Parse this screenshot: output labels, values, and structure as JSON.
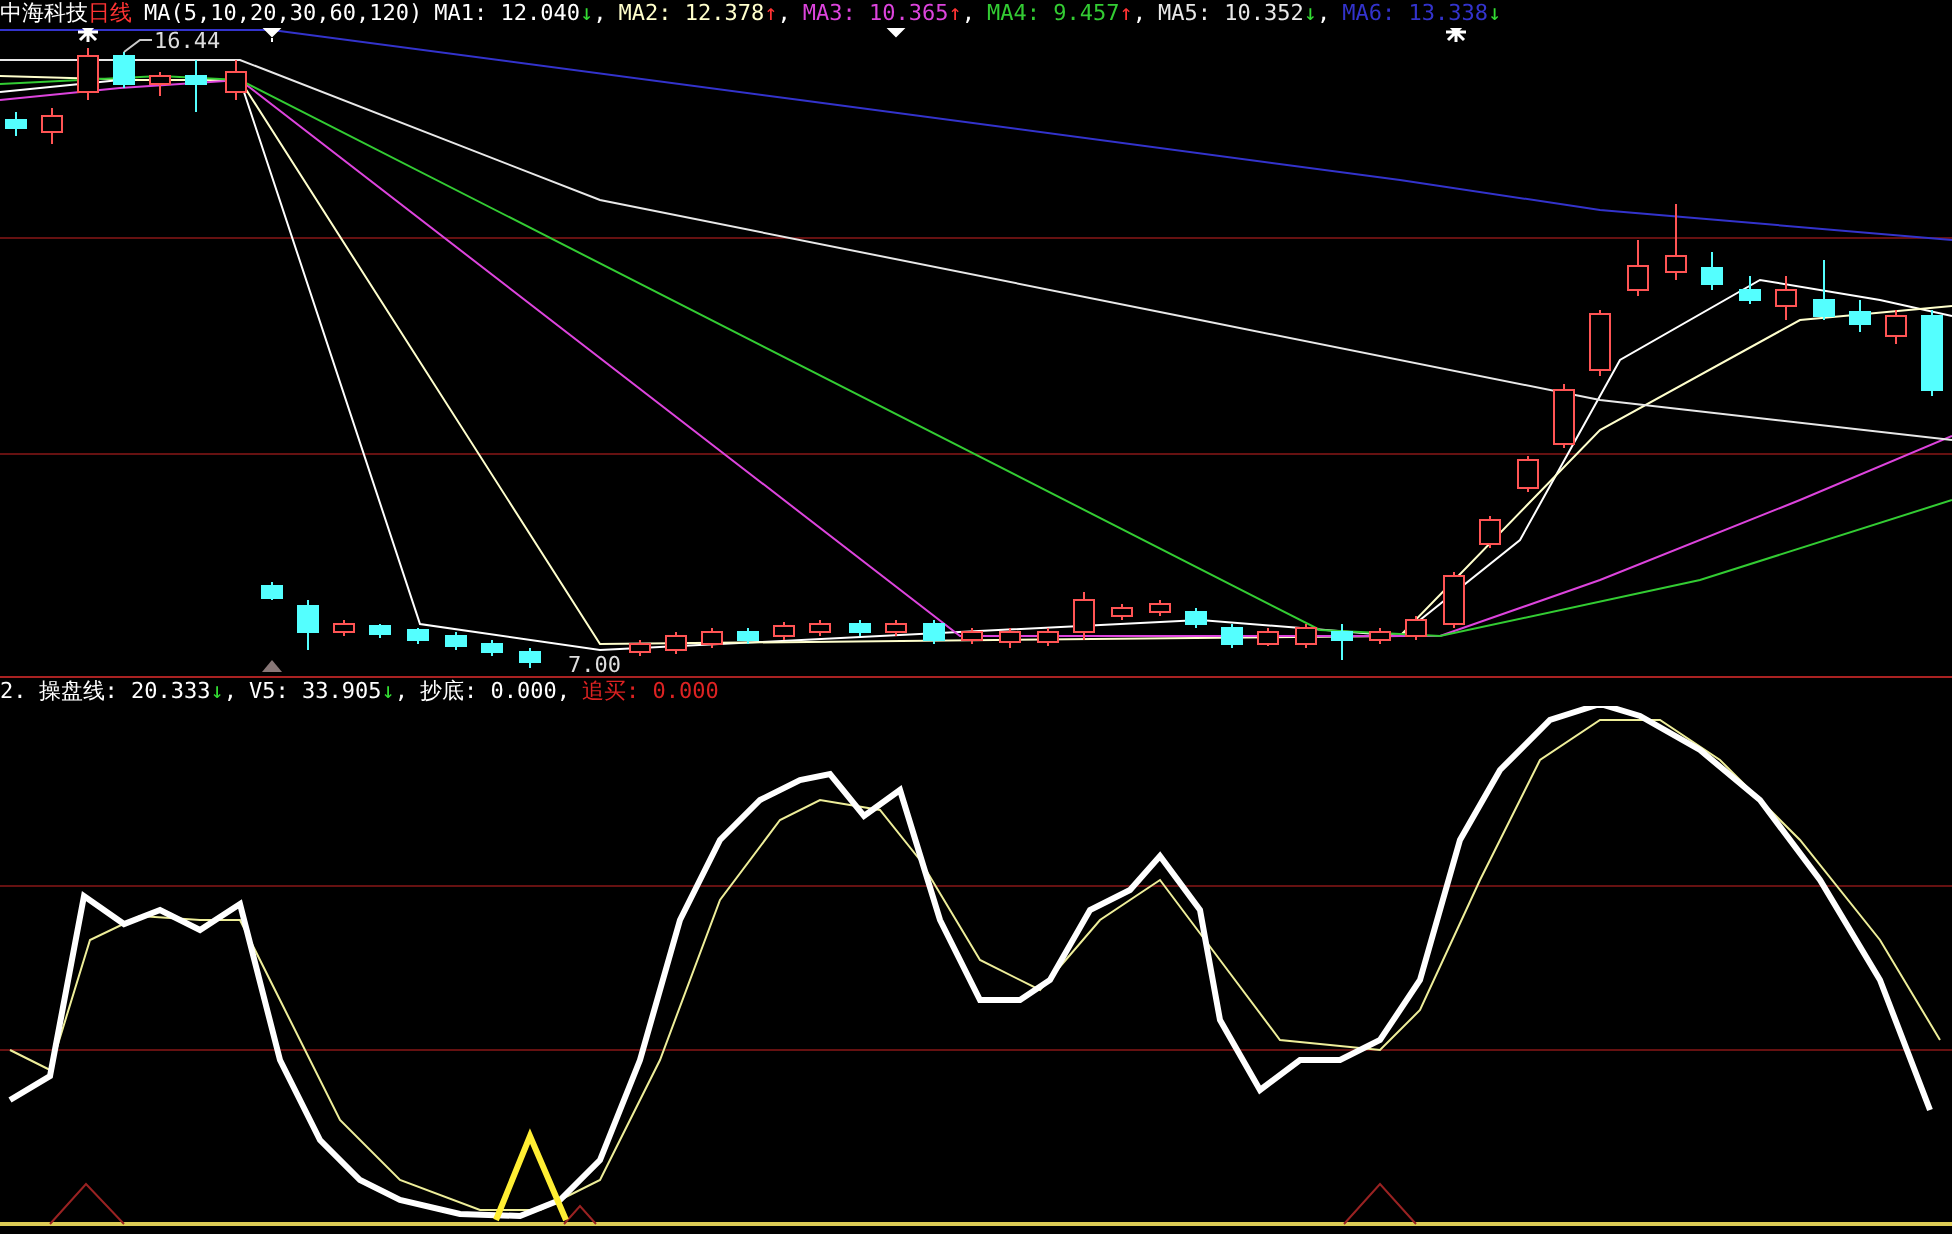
{
  "main_header": {
    "stock": "中海科技",
    "period": "日线",
    "formula": "MA(5,10,20,30,60,120)",
    "items": [
      {
        "label": "MA1:",
        "value": "12.040",
        "arrow": {
          "symbol": "↓",
          "color": "#33dd33"
        },
        "suffix": ",",
        "color": "#ffffff"
      },
      {
        "label": "MA2:",
        "value": "12.378",
        "arrow": {
          "symbol": "↑",
          "color": "#ff3333"
        },
        "suffix": ",",
        "color": "#ffffcc"
      },
      {
        "label": "MA3:",
        "value": "10.365",
        "arrow": {
          "symbol": "↑",
          "color": "#ff3333"
        },
        "suffix": ",",
        "color": "#dd44dd"
      },
      {
        "label": "MA4:",
        "value": "9.457",
        "arrow": {
          "symbol": "↑",
          "color": "#ff3333"
        },
        "suffix": ",",
        "color": "#33cc33"
      },
      {
        "label": "MA5:",
        "value": "10.352",
        "arrow": {
          "symbol": "↓",
          "color": "#33dd33"
        },
        "suffix": ",",
        "color": "#e8e8e8"
      },
      {
        "label": "MA6:",
        "value": "13.338",
        "arrow": {
          "symbol": "↓",
          "color": "#33dd33"
        },
        "color": "#3333cc"
      }
    ]
  },
  "main_chart": {
    "high_label": "16.44",
    "low_label": "7.00"
  },
  "indicator_header": {
    "index": "2.",
    "items": [
      {
        "label": "操盘线:",
        "value": "20.333",
        "arrow": {
          "symbol": "↓",
          "color": "#33dd33"
        },
        "suffix": ",",
        "color": "#ffffff"
      },
      {
        "label": "V5:",
        "value": "33.905",
        "arrow": {
          "symbol": "↓",
          "color": "#33dd33"
        },
        "suffix": ",",
        "color": "#ffffff"
      },
      {
        "label": "抄底:",
        "value": "0.000",
        "suffix": ",",
        "color": "#ffffff"
      },
      {
        "label": "追买:",
        "value": "0.000",
        "color": "#dd2222"
      }
    ]
  }
}
